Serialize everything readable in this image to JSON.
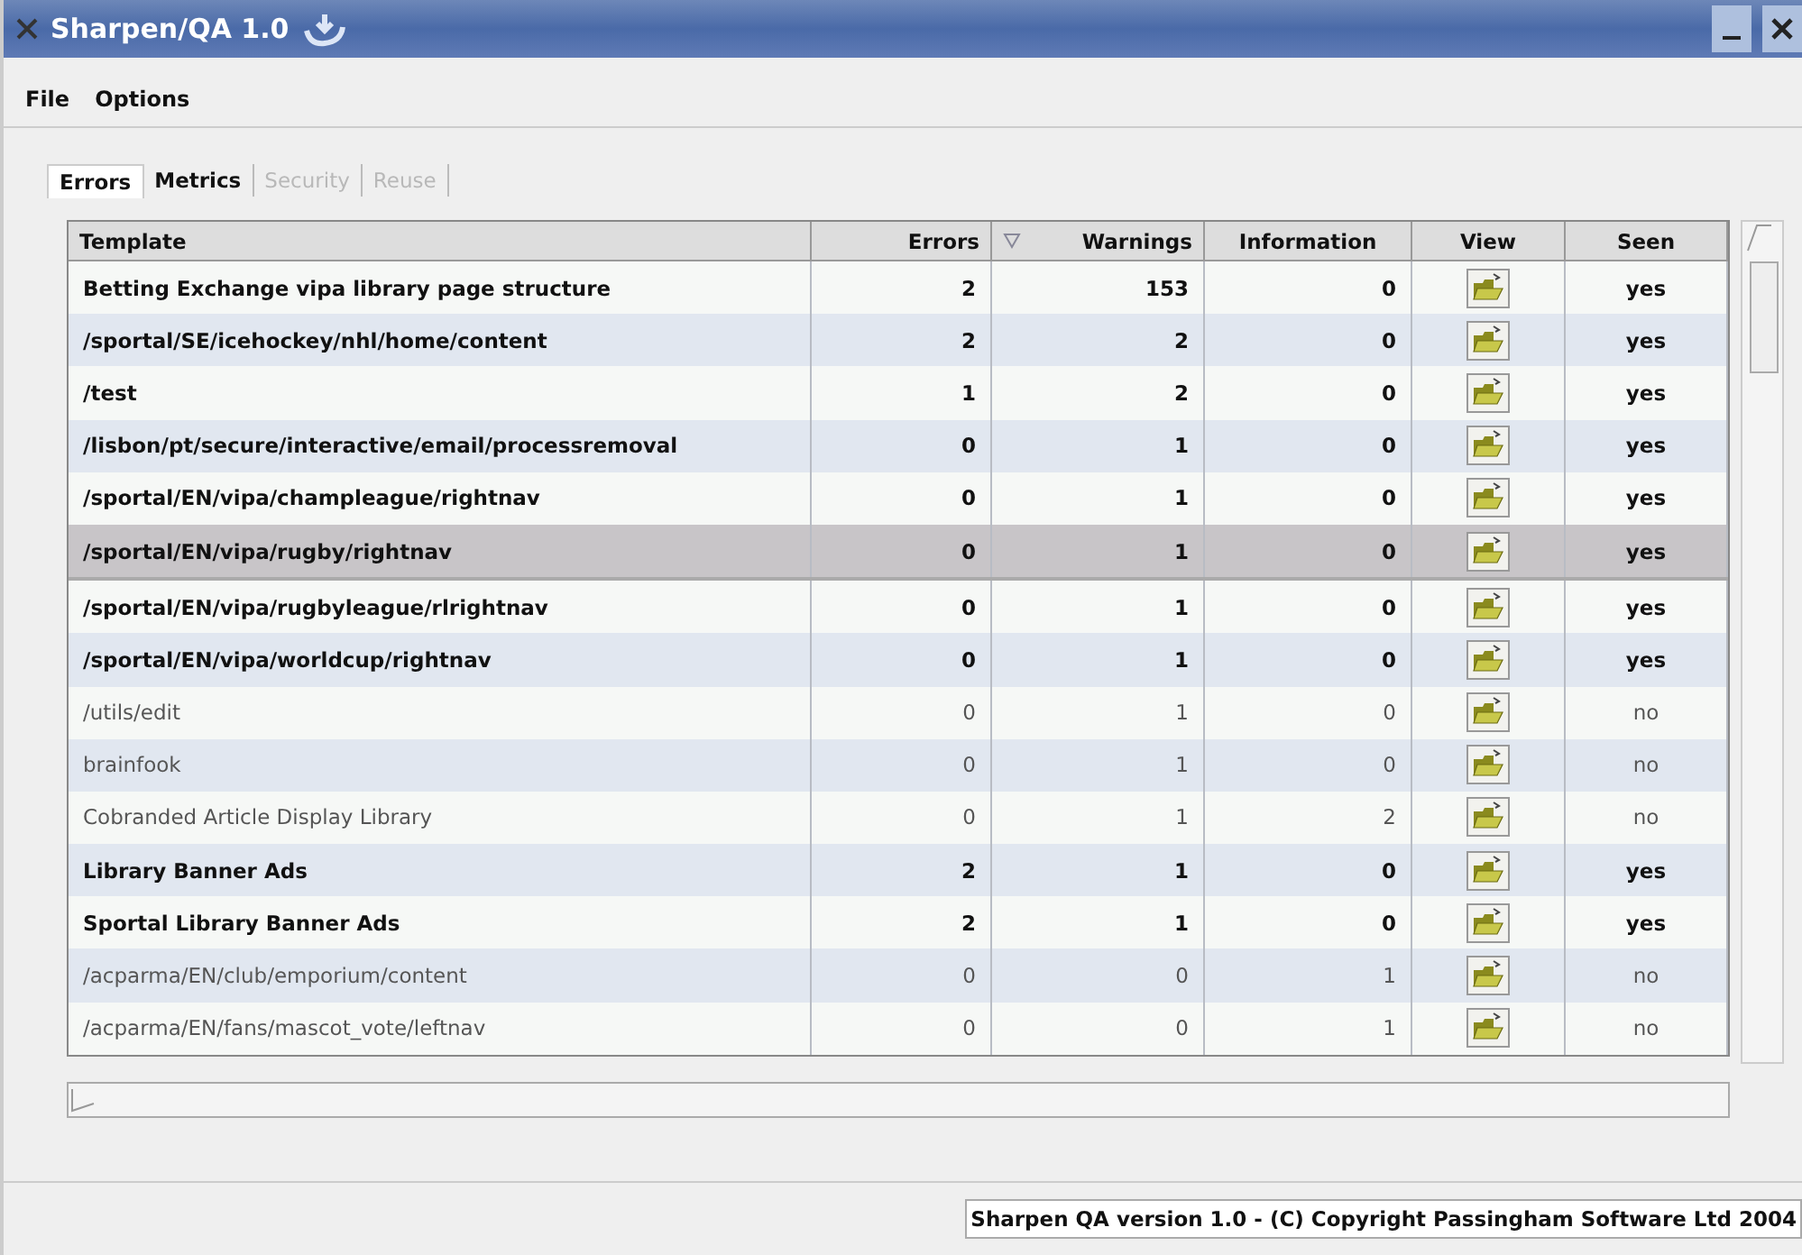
{
  "window": {
    "title": "Sharpen/QA 1.0"
  },
  "menu": [
    "File",
    "Options"
  ],
  "tabs": [
    {
      "label": "Errors",
      "selected": true,
      "disabled": false
    },
    {
      "label": "Metrics",
      "selected": false,
      "disabled": false
    },
    {
      "label": "Security",
      "selected": false,
      "disabled": true
    },
    {
      "label": "Reuse",
      "selected": false,
      "disabled": true
    }
  ],
  "table": {
    "columns": [
      {
        "label": "Template",
        "sorted": false
      },
      {
        "label": "Errors",
        "sorted": false
      },
      {
        "label": "Warnings",
        "sorted": true
      },
      {
        "label": "Information",
        "sorted": false
      },
      {
        "label": "View",
        "sorted": false
      },
      {
        "label": "Seen",
        "sorted": false
      }
    ],
    "rows": [
      {
        "template": "Betting Exchange vipa library page structure",
        "errors": "2",
        "warnings": "153",
        "information": "0",
        "seen": "yes",
        "bold": true,
        "selected": false
      },
      {
        "template": "/sportal/SE/icehockey/nhl/home/content",
        "errors": "2",
        "warnings": "2",
        "information": "0",
        "seen": "yes",
        "bold": true,
        "selected": false
      },
      {
        "template": "/test",
        "errors": "1",
        "warnings": "2",
        "information": "0",
        "seen": "yes",
        "bold": true,
        "selected": false
      },
      {
        "template": "/lisbon/pt/secure/interactive/email/processremoval",
        "errors": "0",
        "warnings": "1",
        "information": "0",
        "seen": "yes",
        "bold": true,
        "selected": false
      },
      {
        "template": "/sportal/EN/vipa/champleague/rightnav",
        "errors": "0",
        "warnings": "1",
        "information": "0",
        "seen": "yes",
        "bold": true,
        "selected": false
      },
      {
        "template": "/sportal/EN/vipa/rugby/rightnav",
        "errors": "0",
        "warnings": "1",
        "information": "0",
        "seen": "yes",
        "bold": true,
        "selected": true
      },
      {
        "template": "/sportal/EN/vipa/rugbyleague/rlrightnav",
        "errors": "0",
        "warnings": "1",
        "information": "0",
        "seen": "yes",
        "bold": true,
        "selected": false
      },
      {
        "template": "/sportal/EN/vipa/worldcup/rightnav",
        "errors": "0",
        "warnings": "1",
        "information": "0",
        "seen": "yes",
        "bold": true,
        "selected": false
      },
      {
        "template": "/utils/edit",
        "errors": "0",
        "warnings": "1",
        "information": "0",
        "seen": "no",
        "bold": false,
        "selected": false
      },
      {
        "template": "brainfook",
        "errors": "0",
        "warnings": "1",
        "information": "0",
        "seen": "no",
        "bold": false,
        "selected": false
      },
      {
        "template": "Cobranded Article Display Library",
        "errors": "0",
        "warnings": "1",
        "information": "2",
        "seen": "no",
        "bold": false,
        "selected": false
      },
      {
        "template": "Library Banner Ads",
        "errors": "2",
        "warnings": "1",
        "information": "0",
        "seen": "yes",
        "bold": true,
        "selected": false
      },
      {
        "template": "Sportal Library Banner Ads",
        "errors": "2",
        "warnings": "1",
        "information": "0",
        "seen": "yes",
        "bold": true,
        "selected": false
      },
      {
        "template": "/acparma/EN/club/emporium/content",
        "errors": "0",
        "warnings": "0",
        "information": "1",
        "seen": "no",
        "bold": false,
        "selected": false
      },
      {
        "template": "/acparma/EN/fans/mascot_vote/leftnav",
        "errors": "0",
        "warnings": "0",
        "information": "1",
        "seen": "no",
        "bold": false,
        "selected": false
      }
    ]
  },
  "status_bar": "Sharpen QA version 1.0 - (C) Copyright Passingham Software Ltd 2004"
}
